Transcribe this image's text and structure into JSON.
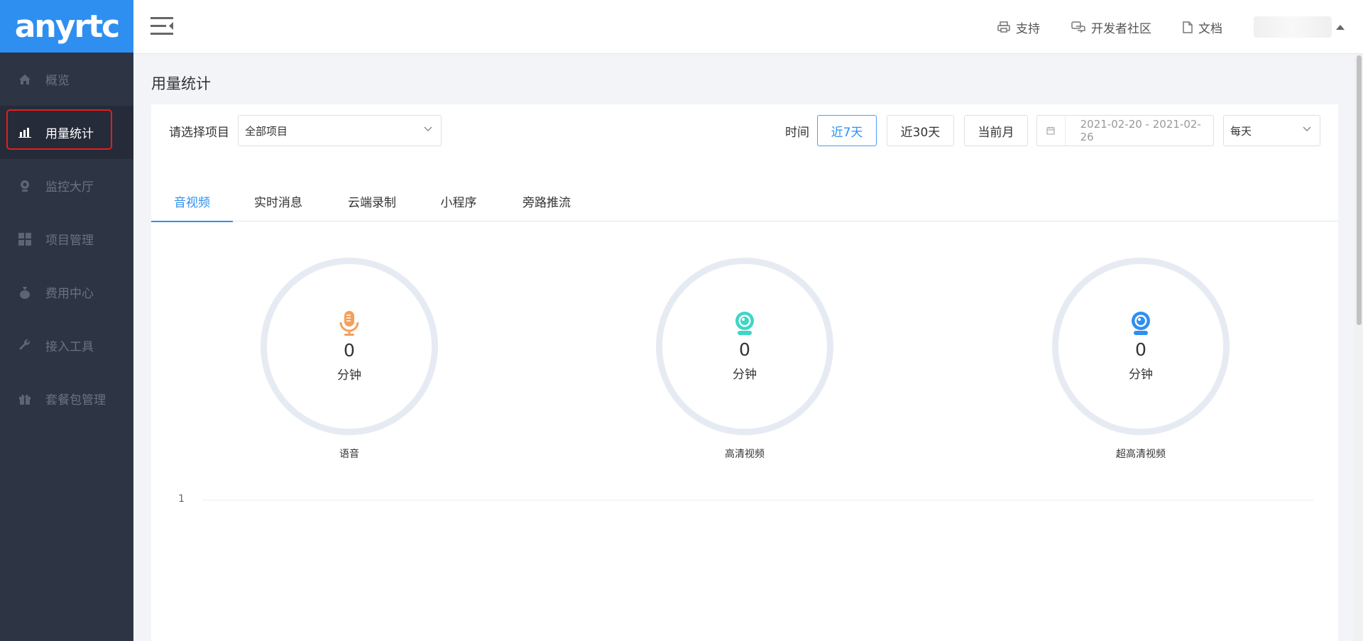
{
  "brand": {
    "logo_text": "anyrtc",
    "accent": "#2f8ff0",
    "highlight_color": "#e81c1c"
  },
  "sidebar": {
    "items": [
      {
        "label": "概览",
        "icon": "home-icon"
      },
      {
        "label": "用量统计",
        "icon": "bar-chart-icon",
        "active": true
      },
      {
        "label": "监控大厅",
        "icon": "webcam-icon"
      },
      {
        "label": "项目管理",
        "icon": "grid-icon"
      },
      {
        "label": "费用中心",
        "icon": "money-bag-icon"
      },
      {
        "label": "接入工具",
        "icon": "wrench-icon"
      },
      {
        "label": "套餐包管理",
        "icon": "gift-icon"
      }
    ]
  },
  "header": {
    "links": [
      {
        "label": "支持",
        "icon": "printer-icon"
      },
      {
        "label": "开发者社区",
        "icon": "chat-icon"
      },
      {
        "label": "文档",
        "icon": "document-icon"
      }
    ]
  },
  "page": {
    "title": "用量统计"
  },
  "filter": {
    "project_label": "请选择项目",
    "project_value": "全部项目",
    "time_label": "时间",
    "buttons": [
      "近7天",
      "近30天",
      "当前月"
    ],
    "active_button": "近7天",
    "date_range": "2021-02-20 - 2021-02-26",
    "granularity": "每天"
  },
  "tabs": [
    "音视频",
    "实时消息",
    "云端录制",
    "小程序",
    "旁路推流"
  ],
  "stats": [
    {
      "value": "0",
      "unit": "分钟",
      "label": "语音",
      "icon": "microphone-icon",
      "color": "#f5a05a"
    },
    {
      "value": "0",
      "unit": "分钟",
      "label": "高清视频",
      "icon": "webcam-icon",
      "color": "#3fd6c6"
    },
    {
      "value": "0",
      "unit": "分钟",
      "label": "超高清视频",
      "icon": "webcam-icon",
      "color": "#2f8ff0"
    }
  ],
  "chart": {
    "y_tick": "1"
  }
}
